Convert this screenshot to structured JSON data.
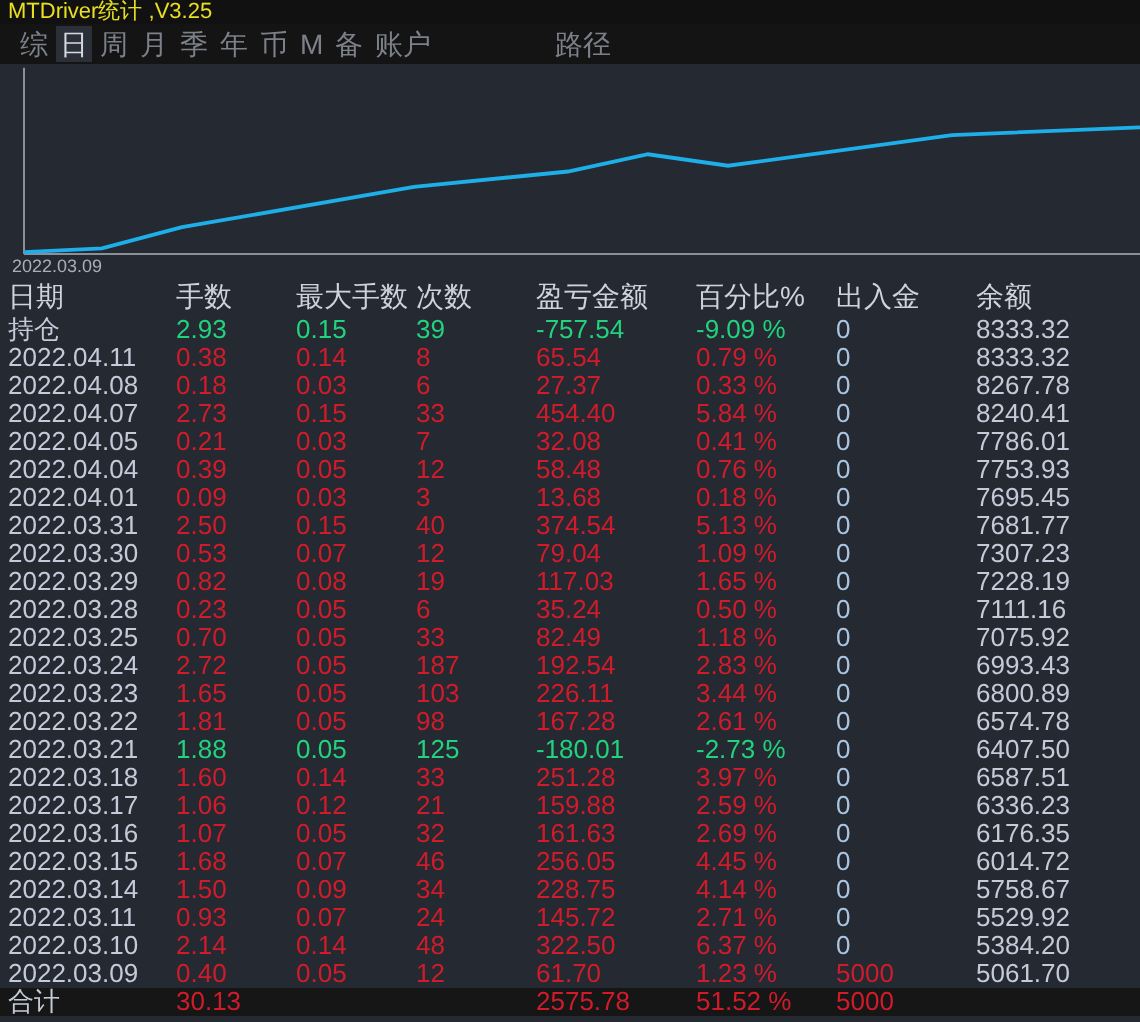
{
  "window": {
    "title": "MTDriver统计 ,V3.25"
  },
  "tabs": [
    {
      "label": "综",
      "selected": false
    },
    {
      "label": "日",
      "selected": true
    },
    {
      "label": "周",
      "selected": false
    },
    {
      "label": "月",
      "selected": false
    },
    {
      "label": "季",
      "selected": false
    },
    {
      "label": "年",
      "selected": false
    },
    {
      "label": "币",
      "selected": false
    },
    {
      "label": "M",
      "selected": false
    },
    {
      "label": "备",
      "selected": false
    },
    {
      "label": "账户",
      "selected": false
    },
    {
      "label": "路径",
      "selected": false
    }
  ],
  "chart": {
    "start_label": "2022.03.09"
  },
  "table": {
    "columns": [
      "日期",
      "手数",
      "最大手数",
      "次数",
      "盈亏金额",
      "百分比%",
      "出入金",
      "余额"
    ],
    "rows": [
      {
        "date": "持仓",
        "lots": "2.93",
        "max_lots": "0.15",
        "trades": "39",
        "pnl": "-757.54",
        "pct": "-9.09 %",
        "flow": "0",
        "balance": "8333.32",
        "kind": "down",
        "deposit": false
      },
      {
        "date": "2022.04.11",
        "lots": "0.38",
        "max_lots": "0.14",
        "trades": "8",
        "pnl": "65.54",
        "pct": "0.79 %",
        "flow": "0",
        "balance": "8333.32",
        "kind": "up",
        "deposit": false
      },
      {
        "date": "2022.04.08",
        "lots": "0.18",
        "max_lots": "0.03",
        "trades": "6",
        "pnl": "27.37",
        "pct": "0.33 %",
        "flow": "0",
        "balance": "8267.78",
        "kind": "up",
        "deposit": false
      },
      {
        "date": "2022.04.07",
        "lots": "2.73",
        "max_lots": "0.15",
        "trades": "33",
        "pnl": "454.40",
        "pct": "5.84 %",
        "flow": "0",
        "balance": "8240.41",
        "kind": "up",
        "deposit": false
      },
      {
        "date": "2022.04.05",
        "lots": "0.21",
        "max_lots": "0.03",
        "trades": "7",
        "pnl": "32.08",
        "pct": "0.41 %",
        "flow": "0",
        "balance": "7786.01",
        "kind": "up",
        "deposit": false
      },
      {
        "date": "2022.04.04",
        "lots": "0.39",
        "max_lots": "0.05",
        "trades": "12",
        "pnl": "58.48",
        "pct": "0.76 %",
        "flow": "0",
        "balance": "7753.93",
        "kind": "up",
        "deposit": false
      },
      {
        "date": "2022.04.01",
        "lots": "0.09",
        "max_lots": "0.03",
        "trades": "3",
        "pnl": "13.68",
        "pct": "0.18 %",
        "flow": "0",
        "balance": "7695.45",
        "kind": "up",
        "deposit": false
      },
      {
        "date": "2022.03.31",
        "lots": "2.50",
        "max_lots": "0.15",
        "trades": "40",
        "pnl": "374.54",
        "pct": "5.13 %",
        "flow": "0",
        "balance": "7681.77",
        "kind": "up",
        "deposit": false
      },
      {
        "date": "2022.03.30",
        "lots": "0.53",
        "max_lots": "0.07",
        "trades": "12",
        "pnl": "79.04",
        "pct": "1.09 %",
        "flow": "0",
        "balance": "7307.23",
        "kind": "up",
        "deposit": false
      },
      {
        "date": "2022.03.29",
        "lots": "0.82",
        "max_lots": "0.08",
        "trades": "19",
        "pnl": "117.03",
        "pct": "1.65 %",
        "flow": "0",
        "balance": "7228.19",
        "kind": "up",
        "deposit": false
      },
      {
        "date": "2022.03.28",
        "lots": "0.23",
        "max_lots": "0.05",
        "trades": "6",
        "pnl": "35.24",
        "pct": "0.50 %",
        "flow": "0",
        "balance": "7111.16",
        "kind": "up",
        "deposit": false
      },
      {
        "date": "2022.03.25",
        "lots": "0.70",
        "max_lots": "0.05",
        "trades": "33",
        "pnl": "82.49",
        "pct": "1.18 %",
        "flow": "0",
        "balance": "7075.92",
        "kind": "up",
        "deposit": false
      },
      {
        "date": "2022.03.24",
        "lots": "2.72",
        "max_lots": "0.05",
        "trades": "187",
        "pnl": "192.54",
        "pct": "2.83 %",
        "flow": "0",
        "balance": "6993.43",
        "kind": "up",
        "deposit": false
      },
      {
        "date": "2022.03.23",
        "lots": "1.65",
        "max_lots": "0.05",
        "trades": "103",
        "pnl": "226.11",
        "pct": "3.44 %",
        "flow": "0",
        "balance": "6800.89",
        "kind": "up",
        "deposit": false
      },
      {
        "date": "2022.03.22",
        "lots": "1.81",
        "max_lots": "0.05",
        "trades": "98",
        "pnl": "167.28",
        "pct": "2.61 %",
        "flow": "0",
        "balance": "6574.78",
        "kind": "up",
        "deposit": false
      },
      {
        "date": "2022.03.21",
        "lots": "1.88",
        "max_lots": "0.05",
        "trades": "125",
        "pnl": "-180.01",
        "pct": "-2.73 %",
        "flow": "0",
        "balance": "6407.50",
        "kind": "down",
        "deposit": false
      },
      {
        "date": "2022.03.18",
        "lots": "1.60",
        "max_lots": "0.14",
        "trades": "33",
        "pnl": "251.28",
        "pct": "3.97 %",
        "flow": "0",
        "balance": "6587.51",
        "kind": "up",
        "deposit": false
      },
      {
        "date": "2022.03.17",
        "lots": "1.06",
        "max_lots": "0.12",
        "trades": "21",
        "pnl": "159.88",
        "pct": "2.59 %",
        "flow": "0",
        "balance": "6336.23",
        "kind": "up",
        "deposit": false
      },
      {
        "date": "2022.03.16",
        "lots": "1.07",
        "max_lots": "0.05",
        "trades": "32",
        "pnl": "161.63",
        "pct": "2.69 %",
        "flow": "0",
        "balance": "6176.35",
        "kind": "up",
        "deposit": false
      },
      {
        "date": "2022.03.15",
        "lots": "1.68",
        "max_lots": "0.07",
        "trades": "46",
        "pnl": "256.05",
        "pct": "4.45 %",
        "flow": "0",
        "balance": "6014.72",
        "kind": "up",
        "deposit": false
      },
      {
        "date": "2022.03.14",
        "lots": "1.50",
        "max_lots": "0.09",
        "trades": "34",
        "pnl": "228.75",
        "pct": "4.14 %",
        "flow": "0",
        "balance": "5758.67",
        "kind": "up",
        "deposit": false
      },
      {
        "date": "2022.03.11",
        "lots": "0.93",
        "max_lots": "0.07",
        "trades": "24",
        "pnl": "145.72",
        "pct": "2.71 %",
        "flow": "0",
        "balance": "5529.92",
        "kind": "up",
        "deposit": false
      },
      {
        "date": "2022.03.10",
        "lots": "2.14",
        "max_lots": "0.14",
        "trades": "48",
        "pnl": "322.50",
        "pct": "6.37 %",
        "flow": "0",
        "balance": "5384.20",
        "kind": "up",
        "deposit": false
      },
      {
        "date": "2022.03.09",
        "lots": "0.40",
        "max_lots": "0.05",
        "trades": "12",
        "pnl": "61.70",
        "pct": "1.23 %",
        "flow": "5000",
        "balance": "5061.70",
        "kind": "up",
        "deposit": true
      }
    ],
    "total": {
      "label": "合计",
      "lots": "30.13",
      "pnl": "2575.78",
      "pct": "51.52 %",
      "flow": "5000"
    }
  }
}
